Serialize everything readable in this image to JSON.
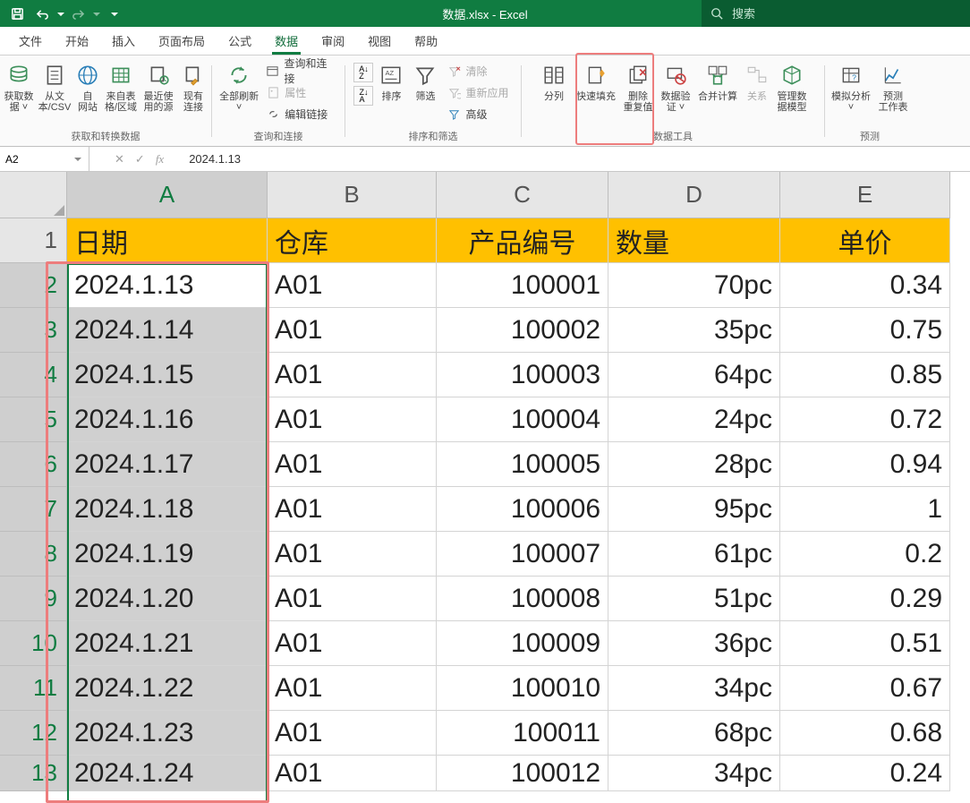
{
  "title": "数据.xlsx  -  Excel",
  "search_placeholder": "搜索",
  "tabs": [
    "文件",
    "开始",
    "插入",
    "页面布局",
    "公式",
    "数据",
    "审阅",
    "视图",
    "帮助"
  ],
  "active_tab": "数据",
  "ribbon_groups": {
    "g1_label": "获取和转换数据",
    "g1_big": [
      {
        "label": "获取数\n据 ˅"
      },
      {
        "label": "从文\n本/CSV"
      },
      {
        "label": "自\n网站"
      },
      {
        "label": "来自表\n格/区域"
      },
      {
        "label": "最近使\n用的源"
      },
      {
        "label": "现有\n连接"
      }
    ],
    "g2_label": "查询和连接",
    "g2_big": {
      "label": "全部刷新\n˅"
    },
    "g2_small": [
      "查询和连接",
      "属性",
      "编辑链接"
    ],
    "g3_label": "排序和筛选",
    "g3_big_sort": "排序",
    "g3_big_filter": "筛选",
    "g3_small": [
      "清除",
      "重新应用",
      "高级"
    ],
    "g4_label": "数据工具",
    "g4_big": [
      {
        "label": "分列"
      },
      {
        "label": "快速填充"
      },
      {
        "label": "删除\n重复值"
      },
      {
        "label": "数据验\n证 ˅"
      },
      {
        "label": "合并计算"
      },
      {
        "label": "关系"
      },
      {
        "label": "管理数\n据模型"
      }
    ],
    "g5_label": "预测",
    "g5_big": [
      {
        "label": "模拟分析\n˅"
      },
      {
        "label": "预测\n工作表"
      }
    ]
  },
  "name_box": "A2",
  "formula_value": "2024.1.13",
  "col_headers": [
    "A",
    "B",
    "C",
    "D",
    "E"
  ],
  "header_row": [
    "日期",
    "仓库",
    "产品编号",
    "数量",
    "单价"
  ],
  "rows": [
    {
      "n": "1"
    },
    {
      "n": "2",
      "A": "2024.1.13",
      "B": "A01",
      "C": "100001",
      "D": "70pc",
      "E": "0.34"
    },
    {
      "n": "3",
      "A": "2024.1.14",
      "B": "A01",
      "C": "100002",
      "D": "35pc",
      "E": "0.75"
    },
    {
      "n": "4",
      "A": "2024.1.15",
      "B": "A01",
      "C": "100003",
      "D": "64pc",
      "E": "0.85"
    },
    {
      "n": "5",
      "A": "2024.1.16",
      "B": "A01",
      "C": "100004",
      "D": "24pc",
      "E": "0.72"
    },
    {
      "n": "6",
      "A": "2024.1.17",
      "B": "A01",
      "C": "100005",
      "D": "28pc",
      "E": "0.94"
    },
    {
      "n": "7",
      "A": "2024.1.18",
      "B": "A01",
      "C": "100006",
      "D": "95pc",
      "E": "1"
    },
    {
      "n": "8",
      "A": "2024.1.19",
      "B": "A01",
      "C": "100007",
      "D": "61pc",
      "E": "0.2"
    },
    {
      "n": "9",
      "A": "2024.1.20",
      "B": "A01",
      "C": "100008",
      "D": "51pc",
      "E": "0.29"
    },
    {
      "n": "10",
      "A": "2024.1.21",
      "B": "A01",
      "C": "100009",
      "D": "36pc",
      "E": "0.51"
    },
    {
      "n": "11",
      "A": "2024.1.22",
      "B": "A01",
      "C": "100010",
      "D": "34pc",
      "E": "0.67"
    },
    {
      "n": "12",
      "A": "2024.1.23",
      "B": "A01",
      "C": "100011",
      "D": "68pc",
      "E": "0.68"
    },
    {
      "n": "13",
      "A": "2024.1.24",
      "B": "A01",
      "C": "100012",
      "D": "34pc",
      "E": "0.24"
    }
  ]
}
